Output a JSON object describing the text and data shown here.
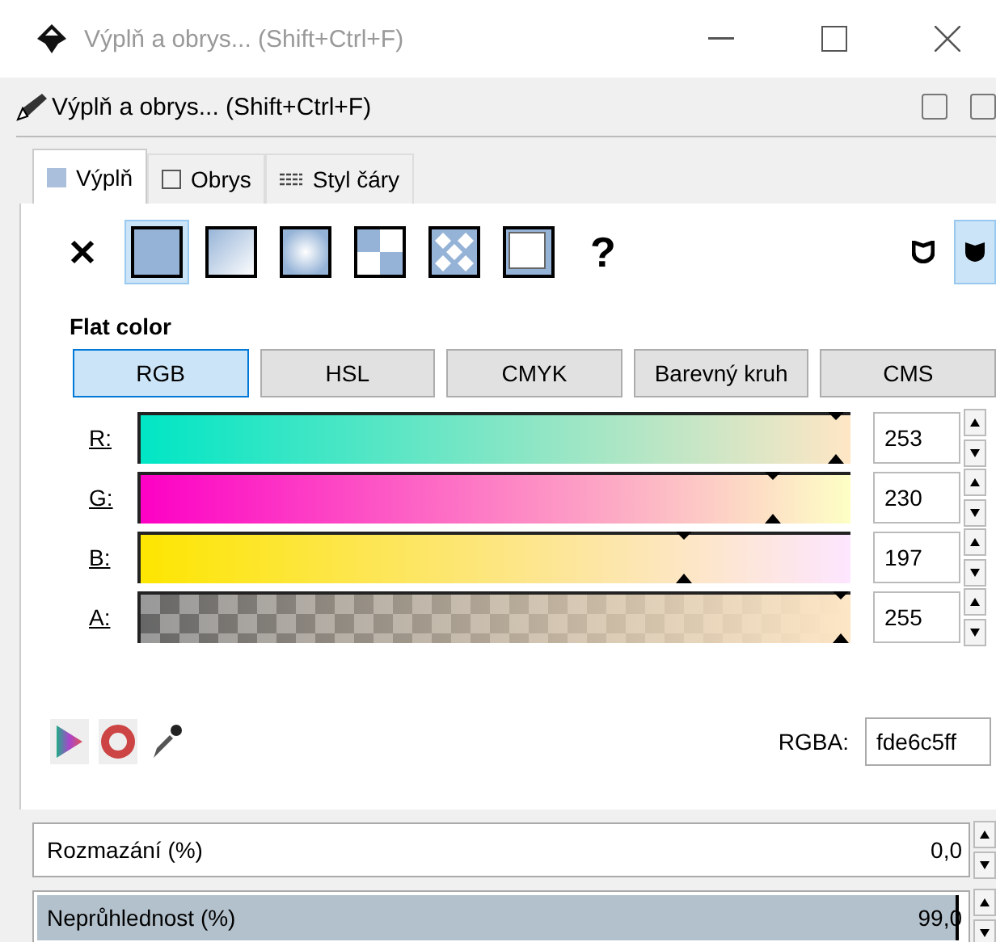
{
  "window": {
    "title": "Výplň a obrys... (Shift+Ctrl+F)"
  },
  "dock": {
    "title": "Výplň a obrys... (Shift+Ctrl+F)"
  },
  "tabs": [
    {
      "label": "Výplň",
      "kind": "fill",
      "selected": true
    },
    {
      "label": "Obrys",
      "kind": "stroke",
      "selected": false
    },
    {
      "label": "Styl čáry",
      "kind": "style",
      "selected": false
    }
  ],
  "paint_types": [
    {
      "kind": "none",
      "selected": false
    },
    {
      "kind": "flat",
      "selected": true
    },
    {
      "kind": "linear",
      "selected": false
    },
    {
      "kind": "radial",
      "selected": false
    },
    {
      "kind": "mesh",
      "selected": false
    },
    {
      "kind": "pattern",
      "selected": false
    },
    {
      "kind": "swatch",
      "selected": false
    },
    {
      "kind": "unset",
      "label": "?",
      "selected": false
    }
  ],
  "fill_rules": [
    {
      "kind": "evenodd",
      "selected": false
    },
    {
      "kind": "nonzero",
      "selected": true
    }
  ],
  "section_title": "Flat color",
  "modes": [
    {
      "label": "RGB",
      "selected": true
    },
    {
      "label": "HSL",
      "selected": false
    },
    {
      "label": "CMYK",
      "selected": false
    },
    {
      "label": "Barevný kruh",
      "selected": false
    },
    {
      "label": "CMS",
      "selected": false
    }
  ],
  "channels": [
    {
      "label": "R:",
      "kind": "r",
      "level": 0.992,
      "value": "253"
    },
    {
      "label": "G:",
      "kind": "g",
      "level": 0.902,
      "value": "230"
    },
    {
      "label": "B:",
      "kind": "b",
      "level": 0.773,
      "value": "197"
    },
    {
      "label": "A:",
      "kind": "a",
      "level": 1.0,
      "value": "255"
    }
  ],
  "rgba": {
    "label": "RGBA:",
    "value": "fde6c5ff"
  },
  "blur": {
    "label": "Rozmazání (%)",
    "value": "0,0"
  },
  "opacity": {
    "label": "Neprůhlednost (%)",
    "value": "99,0",
    "level": 0.99
  }
}
